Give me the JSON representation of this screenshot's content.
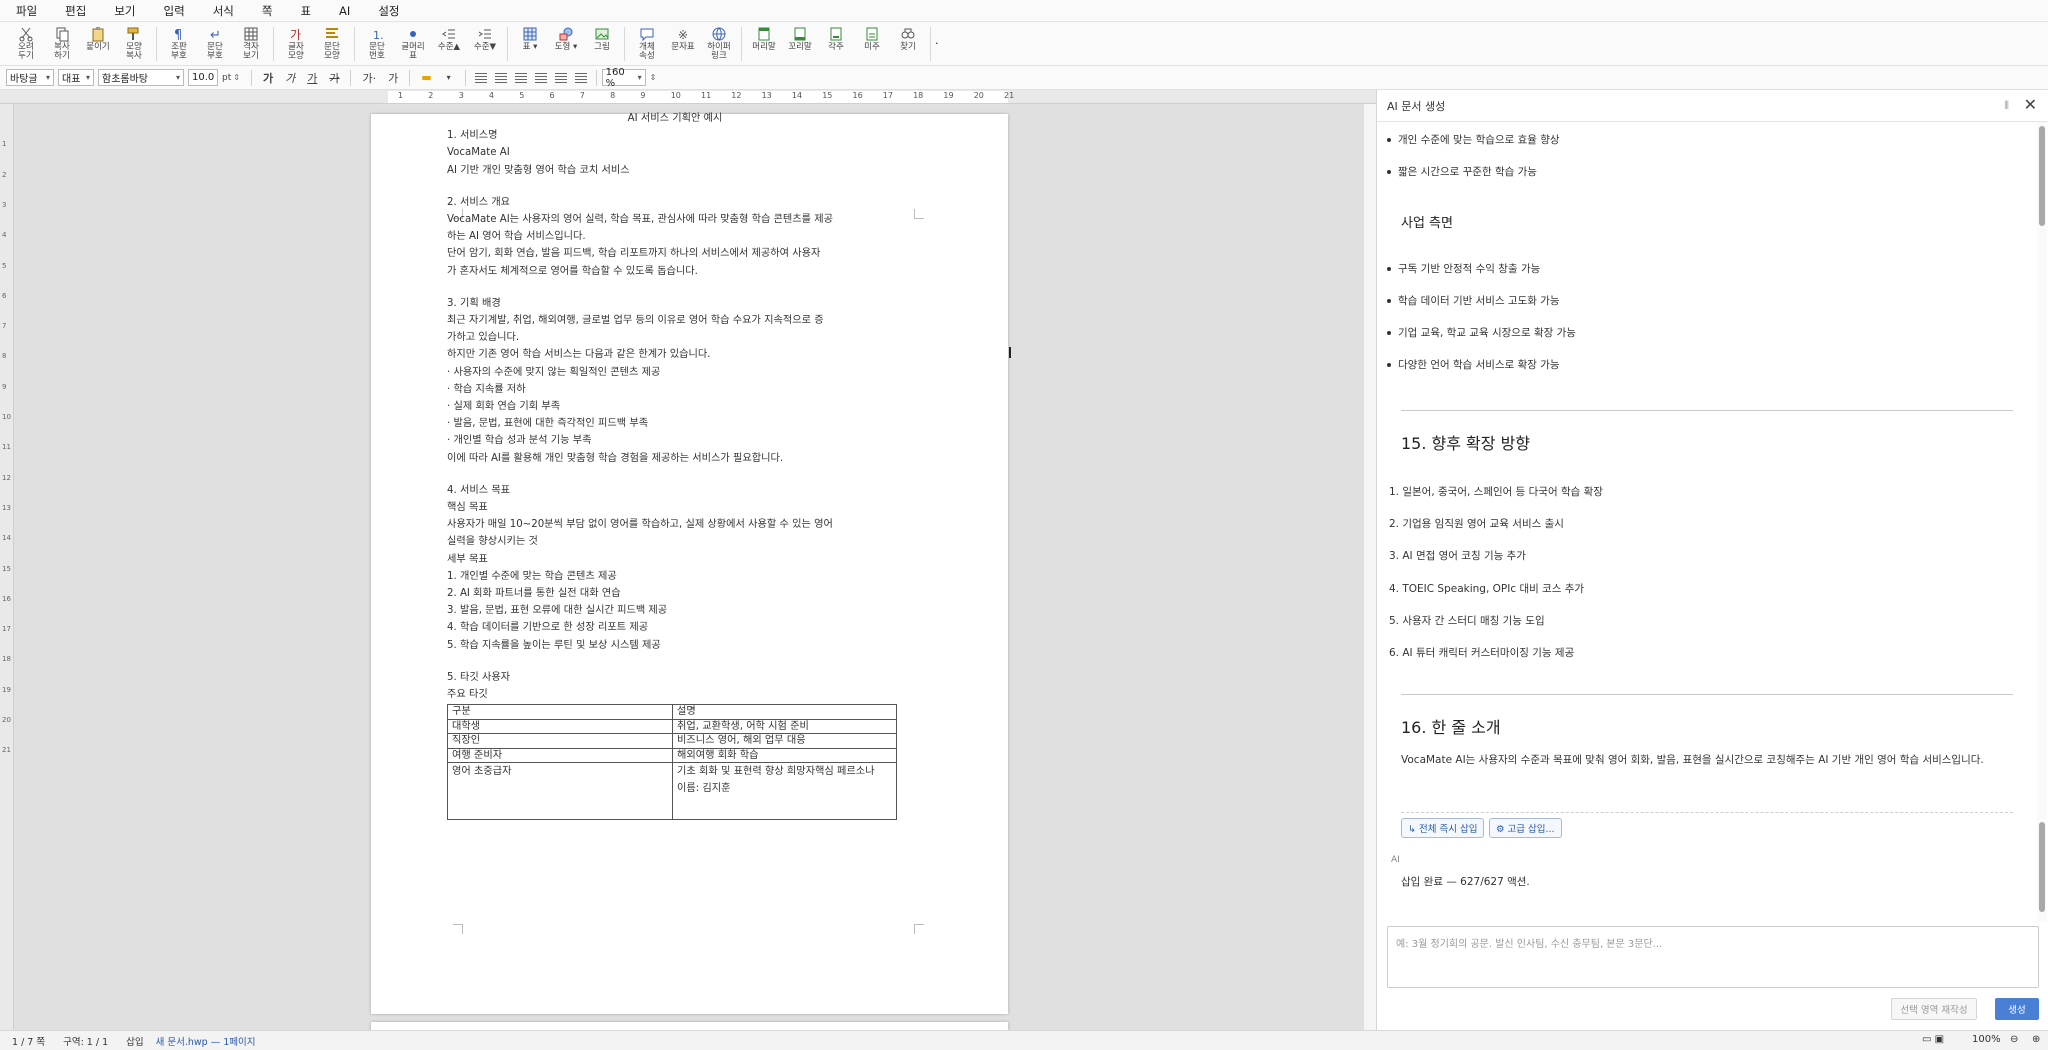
{
  "menu": [
    "파일",
    "편집",
    "보기",
    "입력",
    "서식",
    "쪽",
    "표",
    "AI",
    "설정"
  ],
  "toolbar": {
    "groups": [
      [
        {
          "icon": "cut-icon",
          "label": "오려\n두기"
        },
        {
          "icon": "copy-icon",
          "label": "복사\n하기"
        },
        {
          "icon": "paste-icon",
          "label": "붙이기"
        },
        {
          "icon": "format-copy-icon",
          "label": "모양\n복사"
        }
      ],
      [
        {
          "icon": "pilcrow-icon",
          "label": "조판\n부호"
        },
        {
          "icon": "paragraph-mark-icon",
          "label": "문단\n부호"
        },
        {
          "icon": "grid-icon",
          "label": "격자\n보기"
        }
      ],
      [
        {
          "icon": "char-shape-icon",
          "label": "글자\n모양"
        },
        {
          "icon": "para-shape-icon",
          "label": "문단\n모양"
        }
      ],
      [
        {
          "icon": "para-number-icon",
          "label": "문단\n번호"
        },
        {
          "icon": "bullet-icon",
          "label": "글머리\n표"
        },
        {
          "icon": "outdent-icon",
          "label": "수준▲"
        },
        {
          "icon": "indent-icon",
          "label": "수준▼"
        }
      ],
      [
        {
          "icon": "table-icon",
          "label": "표 ▾"
        },
        {
          "icon": "shape-icon",
          "label": "도형 ▾"
        },
        {
          "icon": "image-icon",
          "label": "그림"
        }
      ],
      [
        {
          "icon": "comment-icon",
          "label": "개체\n속성"
        },
        {
          "icon": "symbol-icon",
          "label": "문자표"
        },
        {
          "icon": "hyperlink-icon",
          "label": "하이퍼\n링크"
        }
      ],
      [
        {
          "icon": "header-icon",
          "label": "머리말"
        },
        {
          "icon": "footer-icon",
          "label": "꼬리말"
        },
        {
          "icon": "footnote-icon",
          "label": "각주"
        },
        {
          "icon": "endnote-icon",
          "label": "미주"
        },
        {
          "icon": "find-icon",
          "label": "찾기"
        }
      ]
    ],
    "more": "·"
  },
  "format": {
    "style": "바탕글",
    "lang": "대표",
    "font": "함초롬바탕",
    "size": "10.0",
    "unit": "pt",
    "buttons": [
      "가",
      "가",
      "가",
      "가",
      "가·",
      "가"
    ],
    "zoom": "160 %"
  },
  "ruler_numbers": [
    "1",
    "2",
    "3",
    "4",
    "5",
    "6",
    "7",
    "8",
    "9",
    "10",
    "11",
    "12",
    "13",
    "14",
    "15",
    "16",
    "17",
    "18",
    "19",
    "20",
    "21"
  ],
  "document": {
    "title": "AI 서비스 기획안 예시",
    "lines": [
      "1. 서비스명",
      "VocaMate AI",
      "AI 기반 개인 맞춤형 영어 학습 코치 서비스",
      "",
      "2. 서비스 개요",
      "VocaMate AI는 사용자의 영어 실력, 학습 목표, 관심사에 따라 맞춤형 학습 콘텐츠를 제공",
      "하는 AI 영어 학습 서비스입니다.",
      "단어 암기, 회화 연습, 발음 피드백, 학습 리포트까지 하나의 서비스에서 제공하여 사용자",
      "가 혼자서도 체계적으로 영어를 학습할 수 있도록 돕습니다.",
      "",
      "3. 기획 배경",
      "최근 자기계발, 취업, 해외여행, 글로벌 업무 등의 이유로 영어 학습 수요가 지속적으로 증",
      "가하고 있습니다.",
      "하지만 기존 영어 학습 서비스는 다음과 같은 한계가 있습니다.",
      "· 사용자의 수준에 맞지 않는 획일적인 콘텐츠 제공",
      "· 학습 지속률 저하",
      "· 실제 회화 연습 기회 부족",
      "· 발음, 문법, 표현에 대한 즉각적인 피드백 부족",
      "· 개인별 학습 성과 분석 기능 부족",
      "이에 따라 AI를 활용해 개인 맞춤형 학습 경험을 제공하는 서비스가 필요합니다.",
      "",
      "4. 서비스 목표",
      "핵심 목표",
      "사용자가 매일 10~20분씩 부담 없이 영어를 학습하고, 실제 상황에서 사용할 수 있는 영어",
      "실력을 향상시키는 것",
      "세부 목표",
      "1. 개인별 수준에 맞는 학습 콘텐츠 제공",
      "2. AI 회화 파트너를 통한 실전 대화 연습",
      "3. 발음, 문법, 표현 오류에 대한 실시간 피드백 제공",
      "4. 학습 데이터를 기반으로 한 성장 리포트 제공",
      "5. 학습 지속률을 높이는 루틴 및 보상 시스템 제공",
      "",
      "5. 타깃 사용자",
      "주요 타깃"
    ],
    "table": {
      "header": [
        "구분",
        "설명"
      ],
      "rows": [
        [
          "대학생",
          "취업, 교환학생, 어학 시험 준비"
        ],
        [
          "직장인",
          "비즈니스 영어, 해외 업무 대응"
        ],
        [
          "여행 준비자",
          "해외여행 회화 학습"
        ],
        [
          "영어 초중급자",
          "기초 회화 및 표현력 향상 희망자핵심 페르소나\n이름: 김지훈"
        ]
      ]
    }
  },
  "ai_panel": {
    "title": "AI 문서 생성",
    "bullets_top": [
      "개인 수준에 맞는 학습으로 효율 향상",
      "짧은 시간으로 꾸준한 학습 가능"
    ],
    "business_heading": "사업 측면",
    "business_bullets": [
      "구독 기반 안정적 수익 창출 가능",
      "학습 데이터 기반 서비스 고도화 가능",
      "기업 교육, 학교 교육 시장으로 확장 가능",
      "다양한 언어 학습 서비스로 확장 가능"
    ],
    "section15": "15. 향후 확장 방향",
    "expansion": [
      "1. 일본어, 중국어, 스페인어 등 다국어 학습 확장",
      "2. 기업용 임직원 영어 교육 서비스 출시",
      "3. AI 면접 영어 코칭 기능 추가",
      "4. TOEIC Speaking, OPIc 대비 코스 추가",
      "5. 사용자 간 스터디 매칭 기능 도입",
      "6. AI 튜터 캐릭터 커스터마이징 기능 제공"
    ],
    "section16": "16. 한 줄 소개",
    "intro": "VocaMate AI는 사용자의 수준과 목표에 맞춰 영어 회화, 발음, 표현을 실시간으로 코칭해주는 AI 기반 개인 영어 학습 서비스입니다.",
    "insert_all": "↳ 전체 즉시 삽입",
    "advanced_insert": "⚙ 고급 삽입...",
    "ai_label": "AI",
    "insert_status": "삽입 완료 — 627/627 액션.",
    "placeholder": "예: 3월 정기회의 공문. 발신 인사팀, 수신 충무팀, 본문 3문단...",
    "regen": "선택 영역 재작성",
    "generate": "생성"
  },
  "status": {
    "page": "1 / 7 쪽",
    "section": "구역: 1 / 1",
    "mode": "삽입",
    "file": "새 문서.hwp — 1페이지",
    "zoom": "100%"
  }
}
